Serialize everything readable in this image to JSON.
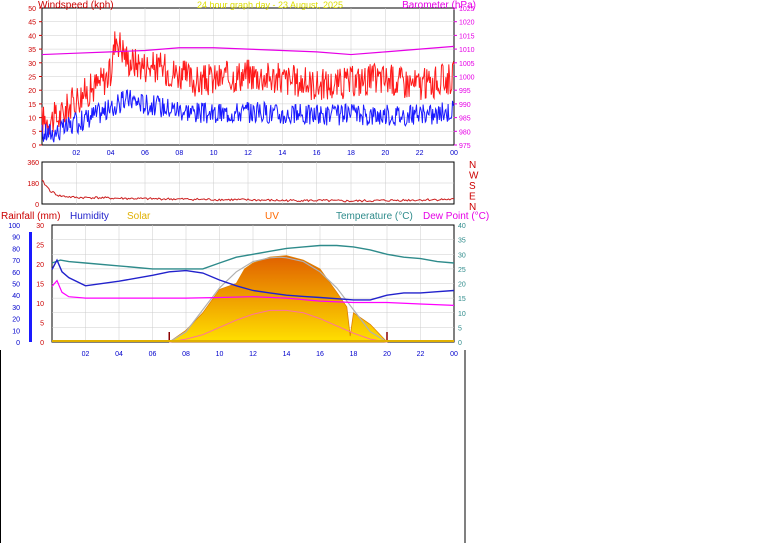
{
  "colors": {
    "wind": "#ff1a1a",
    "gust": "#ff0000",
    "avg_wind": "#1a1aff",
    "barometer": "#e600e6",
    "direction": "#cc2020",
    "humidity": "#2222cc",
    "temperature": "#2e8b8b",
    "dew_point": "#ff00ff",
    "solar": "#ffa500",
    "uv": "#ff6a00",
    "rainfall": "#0000ff",
    "axis_blue": "#0000cc",
    "axis_red": "#cc0000",
    "grid": "#cccccc"
  },
  "chart_data": [
    {
      "type": "line",
      "title": "24 hour graph day - 23 August, 2025",
      "left_axis": {
        "label": "Windspeed (kph)",
        "ylim": [
          0,
          50
        ],
        "ticks": [
          "0",
          "5",
          "10",
          "15",
          "20",
          "25",
          "30",
          "35",
          "40",
          "45",
          "50"
        ]
      },
      "right_axis": {
        "label": "Barometer (hPa)",
        "ylim": [
          975,
          1025
        ],
        "ticks": [
          "975",
          "980",
          "985",
          "990",
          "995",
          "1000",
          "1005",
          "1010",
          "1015",
          "1020",
          "1025"
        ]
      },
      "x_ticks": [
        "02",
        "04",
        "06",
        "08",
        "10",
        "12",
        "14",
        "16",
        "18",
        "20",
        "22",
        "00"
      ],
      "grid": true,
      "series": [
        {
          "key": "gust",
          "x": [
            0,
            1,
            2,
            3,
            4,
            4.3,
            5,
            6,
            7,
            8,
            9,
            10,
            11,
            12,
            13,
            14,
            15,
            16,
            17,
            18,
            19,
            20,
            21,
            22,
            23,
            24
          ],
          "values": [
            9,
            10,
            17,
            21,
            26,
            40,
            31,
            29,
            28,
            26,
            23,
            24,
            25,
            26,
            25,
            24,
            23,
            22,
            22,
            23,
            24,
            24,
            23,
            22,
            23,
            25
          ]
        },
        {
          "key": "avg_wind",
          "x": [
            0,
            1,
            2,
            3,
            4,
            5,
            6,
            7,
            8,
            9,
            10,
            11,
            12,
            13,
            14,
            15,
            16,
            17,
            18,
            19,
            20,
            21,
            22,
            23,
            24
          ],
          "values": [
            4,
            5,
            8,
            11,
            13,
            17,
            15,
            14,
            13,
            12,
            11,
            12,
            12,
            12,
            11,
            11,
            11,
            11,
            11,
            11,
            11,
            11,
            11,
            11,
            13
          ]
        },
        {
          "key": "barometer",
          "x": [
            0,
            2,
            4,
            6,
            8,
            10,
            12,
            14,
            16,
            18,
            20,
            22,
            24
          ],
          "values": [
            1008,
            1008.5,
            1009,
            1009.5,
            1010.5,
            1010.5,
            1010,
            1009.5,
            1009,
            1008,
            1009,
            1010,
            1011
          ]
        }
      ]
    },
    {
      "type": "line",
      "left_axis": {
        "ticks": [
          "360",
          "180",
          "0"
        ],
        "ylim": [
          0,
          360
        ]
      },
      "right_axis": {
        "ticks": [
          "N",
          "W",
          "S",
          "E",
          "N"
        ]
      },
      "grid": true,
      "series": [
        {
          "key": "direction",
          "x": [
            0,
            0.5,
            1,
            2,
            3,
            4,
            6,
            8,
            10,
            12,
            14,
            16,
            18,
            20,
            22,
            24
          ],
          "values": [
            200,
            110,
            70,
            55,
            55,
            50,
            45,
            42,
            38,
            35,
            30,
            30,
            25,
            30,
            35,
            40
          ]
        }
      ]
    },
    {
      "type": "area",
      "axis_labels": [
        "Rainfall (mm)",
        "Humidity",
        "Solar",
        "UV",
        "Temperature (°C)",
        "Dew Point (°C)"
      ],
      "left_axis_outer": {
        "ticks": [
          "0",
          "10",
          "20",
          "30",
          "40",
          "50",
          "60",
          "70",
          "80",
          "90",
          "100"
        ]
      },
      "left_axis_inner": {
        "ticks": [
          "0",
          "5",
          "10",
          "15",
          "20",
          "25",
          "30"
        ]
      },
      "right_axis": {
        "ticks": [
          "0",
          "5",
          "10",
          "15",
          "20",
          "25",
          "30",
          "35",
          "40"
        ],
        "ylim": [
          0,
          40
        ]
      },
      "x_ticks": [
        "02",
        "04",
        "06",
        "08",
        "10",
        "12",
        "14",
        "16",
        "18",
        "20",
        "22",
        "00"
      ],
      "grid": true,
      "series": [
        {
          "key": "temperature",
          "x": [
            0,
            0.5,
            1,
            2,
            4,
            6,
            8,
            9,
            10,
            11,
            12,
            13,
            14,
            15,
            16,
            17,
            18,
            19,
            20,
            21,
            22,
            23,
            24
          ],
          "values": [
            27,
            28,
            27.5,
            27,
            26,
            25,
            25,
            25,
            27,
            29,
            30,
            31,
            32,
            32.5,
            33,
            33,
            32.5,
            31.5,
            30,
            29,
            28.5,
            27.5,
            27
          ]
        },
        {
          "key": "humidity",
          "x": [
            0,
            0.3,
            0.6,
            1,
            2,
            4,
            6,
            7,
            8,
            9,
            10,
            11,
            12,
            13,
            14,
            15,
            16,
            17,
            18,
            19,
            20,
            21,
            22,
            23,
            24
          ],
          "values": [
            62,
            70,
            60,
            55,
            48,
            52,
            57,
            60,
            61,
            59,
            53,
            48,
            44,
            42,
            40,
            39,
            38,
            37,
            36,
            36,
            40,
            42,
            42,
            43,
            44
          ]
        },
        {
          "key": "dew_point",
          "x": [
            0,
            0.3,
            0.6,
            1,
            2,
            4,
            6,
            8,
            10,
            12,
            14,
            16,
            18,
            20,
            22,
            24
          ],
          "values": [
            19,
            21,
            17,
            15.5,
            15,
            15,
            15,
            15,
            15.2,
            15.5,
            15,
            14,
            13.5,
            13.5,
            13,
            12.5
          ]
        },
        {
          "key": "solar",
          "x": [
            7,
            8,
            9,
            10,
            11,
            11.5,
            12,
            13,
            14,
            15,
            16,
            17,
            17.6,
            17.8,
            18,
            19,
            20
          ],
          "values": [
            0,
            4,
            10,
            18,
            20,
            25,
            27,
            29,
            29.5,
            28,
            25,
            17,
            12,
            2,
            10,
            6,
            0
          ]
        },
        {
          "key": "solar_max",
          "x": [
            7,
            8,
            9,
            10,
            11,
            12,
            13,
            13.6,
            14,
            15,
            16,
            17,
            18,
            19,
            20
          ],
          "values": [
            0,
            3.5,
            11,
            18.5,
            24,
            27.5,
            28.8,
            29,
            28.8,
            27.5,
            24,
            18.5,
            11,
            3.5,
            0
          ]
        },
        {
          "key": "uv",
          "x": [
            7,
            8,
            9,
            10,
            11,
            12,
            13,
            14,
            15,
            16,
            17,
            18,
            19,
            20
          ],
          "values": [
            0,
            1,
            2.5,
            5,
            7.5,
            9.5,
            10.8,
            10.8,
            10,
            8,
            5.5,
            3,
            1,
            0
          ]
        }
      ]
    }
  ]
}
